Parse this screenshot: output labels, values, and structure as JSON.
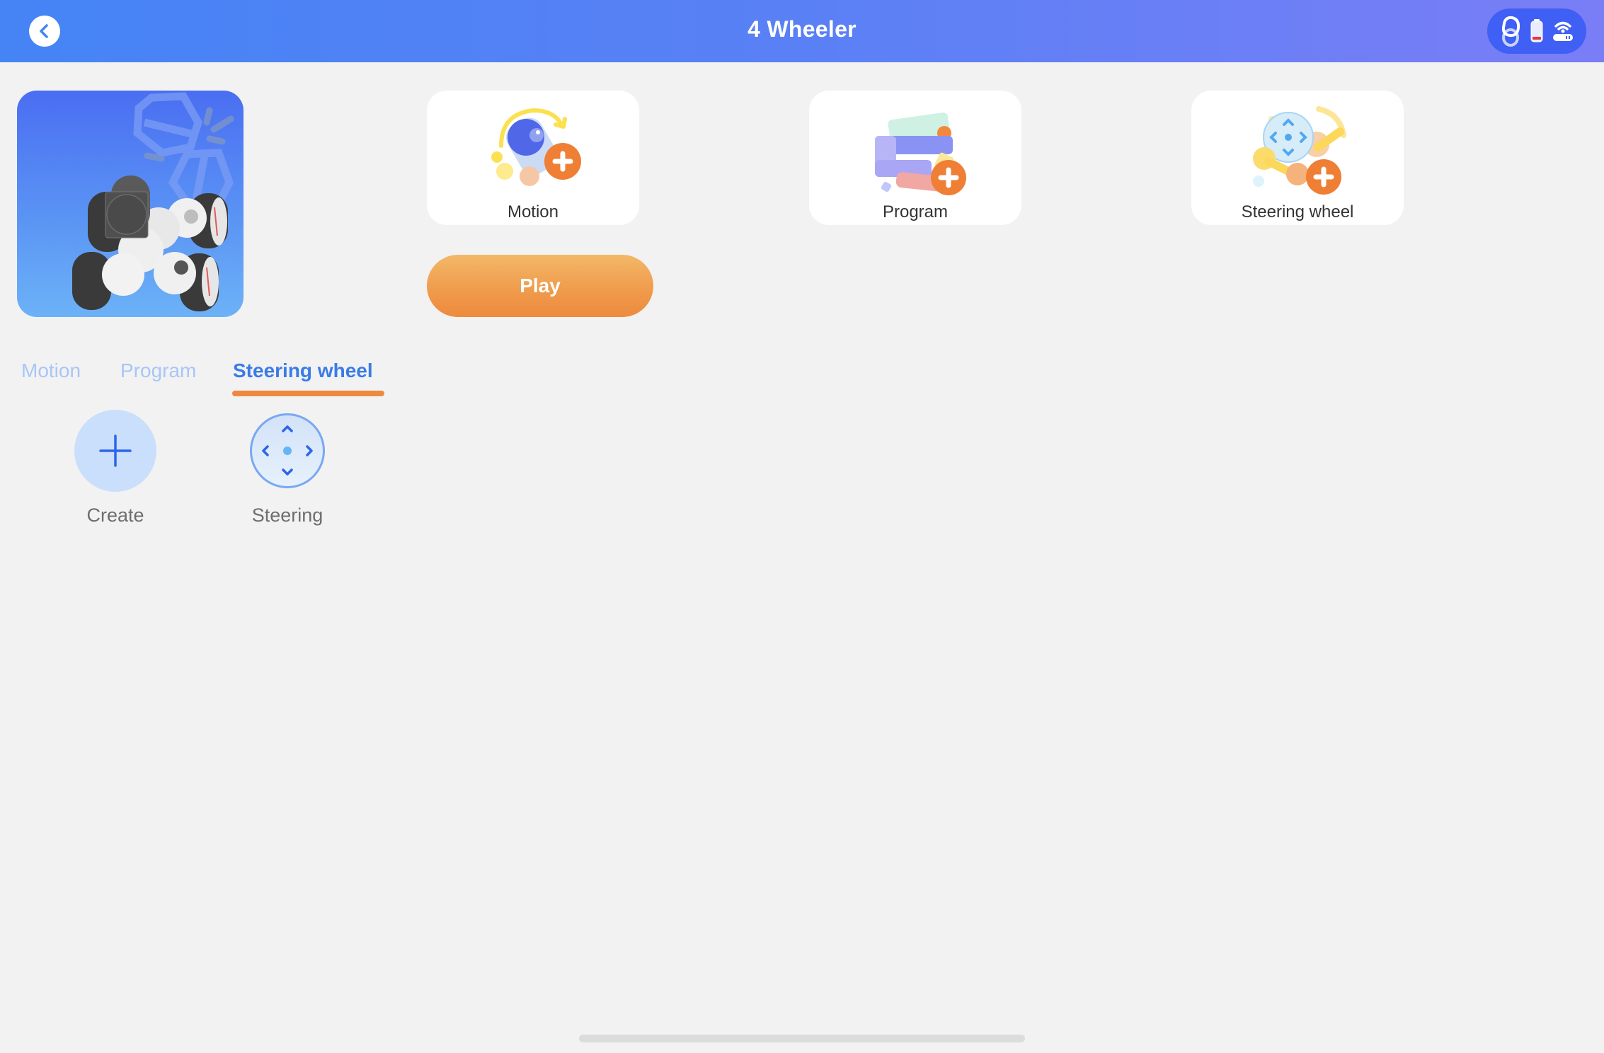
{
  "header": {
    "title": "4 Wheeler",
    "back_icon": "chevron-left-circle-icon",
    "status_icons": [
      "controller-connection-icon",
      "battery-low-icon",
      "wifi-router-icon"
    ]
  },
  "robot_preview": {
    "icon": "four-wheeler-robot-image"
  },
  "mode_cards": [
    {
      "label": "Motion",
      "icon": "motion-add-illustration"
    },
    {
      "label": "Program",
      "icon": "program-add-illustration"
    },
    {
      "label": "Steering wheel",
      "icon": "steering-wheel-add-illustration"
    }
  ],
  "play_button": {
    "label": "Play"
  },
  "tabs": [
    {
      "label": "Motion",
      "active": false
    },
    {
      "label": "Program",
      "active": false
    },
    {
      "label": "Steering wheel",
      "active": true
    }
  ],
  "items": [
    {
      "label": "Create",
      "icon": "plus-icon"
    },
    {
      "label": "Steering",
      "icon": "dpad-icon"
    }
  ],
  "colors": {
    "header_start": "#4584f5",
    "header_end": "#7a7ef6",
    "accent_blue": "#3a7be8",
    "inactive_tab": "#a8c6f7",
    "accent_orange": "#ed8a40",
    "battery_low": "#e53935"
  }
}
